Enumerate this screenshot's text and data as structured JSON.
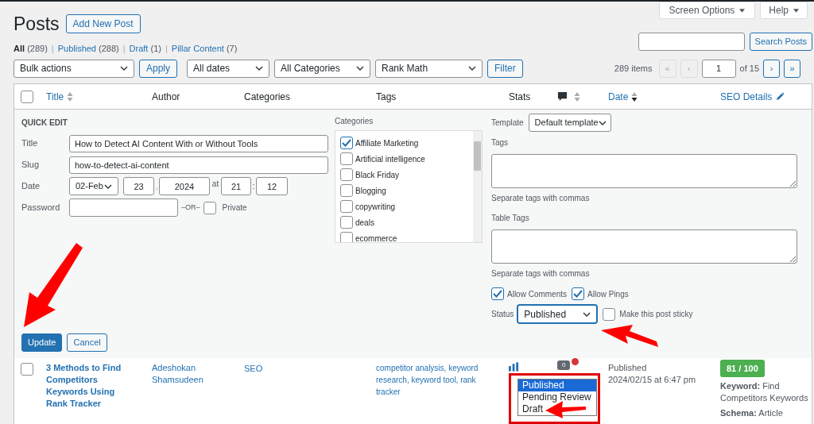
{
  "header": {
    "title": "Posts",
    "add_button": "Add New Post",
    "screen_options": "Screen Options",
    "help": "Help"
  },
  "views_separator": "|",
  "views": [
    {
      "label": "All",
      "count": "(289)",
      "selected": true
    },
    {
      "label": "Published",
      "count": "(288)",
      "selected": false
    },
    {
      "label": "Draft",
      "count": "(1)",
      "selected": false
    },
    {
      "label": "Pillar Content",
      "count": "(7)",
      "selected": false
    }
  ],
  "search": {
    "button": "Search Posts"
  },
  "filters": {
    "bulk": "Bulk actions",
    "apply": "Apply",
    "dates": "All dates",
    "categories": "All Categories",
    "rank_math": "Rank Math",
    "filter": "Filter"
  },
  "pagination": {
    "items": "289 items",
    "first": "«",
    "prev": "‹",
    "page": "1",
    "of": "of 15",
    "next": "›",
    "last": "»"
  },
  "table": {
    "select_all_checked": false,
    "columns": [
      {
        "kind": "sortable",
        "label": "Title",
        "sorted_desc": false
      },
      {
        "kind": "plain",
        "label": "Author"
      },
      {
        "kind": "plain",
        "label": "Categories"
      },
      {
        "kind": "plain",
        "label": "Tags"
      },
      {
        "kind": "plain",
        "label": "Stats"
      },
      {
        "kind": "comments",
        "sorted_desc": false
      },
      {
        "kind": "sortable",
        "label": "Date",
        "sorted_desc": true
      },
      {
        "kind": "editable",
        "label": "SEO Details"
      }
    ]
  },
  "quick_edit": {
    "heading": "QUICK EDIT",
    "title": {
      "label": "Title",
      "value": "How to Detect AI Content With or Without Tools"
    },
    "slug": {
      "label": "Slug",
      "value": "how-to-detect-ai-content"
    },
    "date": {
      "label": "Date",
      "month": "02-Feb",
      "day": "23",
      "sep": ",",
      "year": "2024",
      "at": "at",
      "hour": "21",
      "colon": ":",
      "minute": "12"
    },
    "password": {
      "label": "Password",
      "or": "–OR–",
      "private_label": "Private",
      "private_checked": false
    },
    "categories": {
      "label": "Categories",
      "items": [
        {
          "label": "Affiliate Marketing",
          "checked": true
        },
        {
          "label": "Artificial intelligence",
          "checked": false
        },
        {
          "label": "Black Friday",
          "checked": false
        },
        {
          "label": "Blogging",
          "checked": false
        },
        {
          "label": "copywriting",
          "checked": false
        },
        {
          "label": "deals",
          "checked": false
        },
        {
          "label": "ecommerce",
          "checked": false
        }
      ]
    },
    "template": {
      "label": "Template",
      "value": "Default template"
    },
    "tags": {
      "label": "Tags",
      "hint": "Separate tags with commas"
    },
    "table_tags": {
      "label": "Table Tags",
      "hint": "Separate tags with commas"
    },
    "allow_comments": {
      "label": "Allow Comments",
      "checked": true
    },
    "allow_pings": {
      "label": "Allow Pings",
      "checked": true
    },
    "status": {
      "label": "Status",
      "value": "Published",
      "expanded": true,
      "options": [
        {
          "label": "Published",
          "selected": true
        },
        {
          "label": "Pending Review",
          "selected": false
        },
        {
          "label": "Draft",
          "selected": false
        }
      ]
    },
    "sticky": {
      "label": "Make this post sticky",
      "checked": false
    },
    "update": "Update",
    "cancel": "Cancel"
  },
  "rows": [
    {
      "checked": false,
      "title": "3 Methods to Find Competitors Keywords Using Rank Tracker",
      "author": "Adeshokan Shamsudeen",
      "categories": "SEO",
      "tags": "competitor analysis, keyword research, keyword tool, rank tracker",
      "comments": "0",
      "status": "Published",
      "date": "2024/02/15 at 6:47 pm",
      "seo_score": "81 / 100",
      "keyword": "**Keyword:** Find Competitors Keywords",
      "schema": "**Schema:** Article"
    }
  ]
}
